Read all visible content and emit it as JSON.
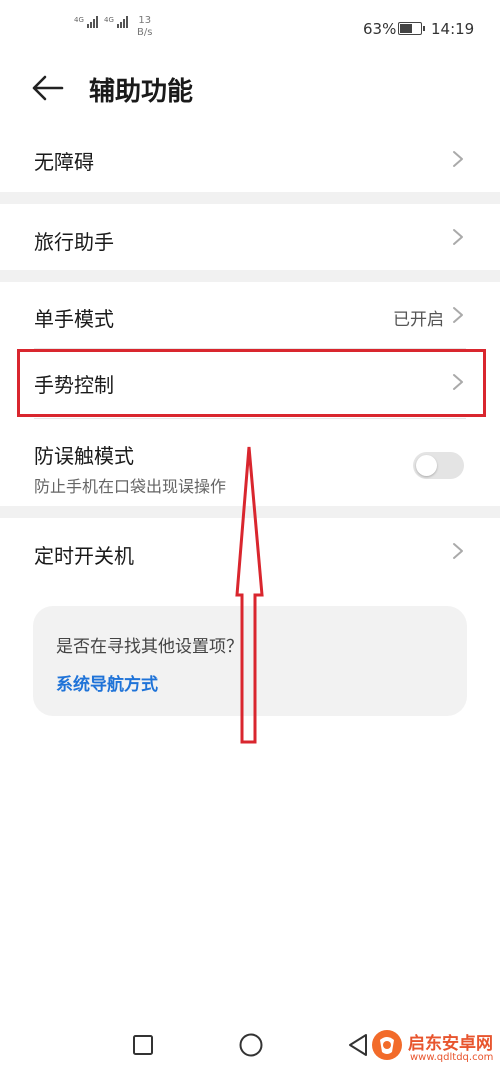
{
  "status_bar": {
    "network_1": "4G",
    "network_2": "4G",
    "speed_value": "13",
    "speed_unit": "B/s",
    "battery_percent": "63%",
    "battery_level": 0.63,
    "time": "14:19"
  },
  "header": {
    "back_icon": "arrow-left-icon",
    "title": "辅助功能"
  },
  "settings": {
    "items": [
      {
        "label": "无障碍"
      },
      {
        "label": "旅行助手"
      },
      {
        "label": "单手模式",
        "value": "已开启"
      },
      {
        "label": "手势控制"
      },
      {
        "label": "防误触模式",
        "subtitle": "防止手机在口袋出现误操作",
        "toggle_on": false
      },
      {
        "label": "定时开关机"
      }
    ]
  },
  "suggestion_card": {
    "question": "是否在寻找其他设置项？",
    "link": "系统导航方式"
  },
  "annotation": {
    "highlight_color": "#d9262e",
    "arrow_color": "#d9262e"
  },
  "nav_bar": {
    "recent_icon": "square-icon",
    "home_icon": "circle-icon",
    "back_icon": "triangle-back-icon"
  },
  "watermark": {
    "title": "启东安卓网",
    "url": "www.qdltdq.com"
  },
  "colors": {
    "accent_link": "#1f73d8",
    "separator": "#f1f1f1"
  }
}
